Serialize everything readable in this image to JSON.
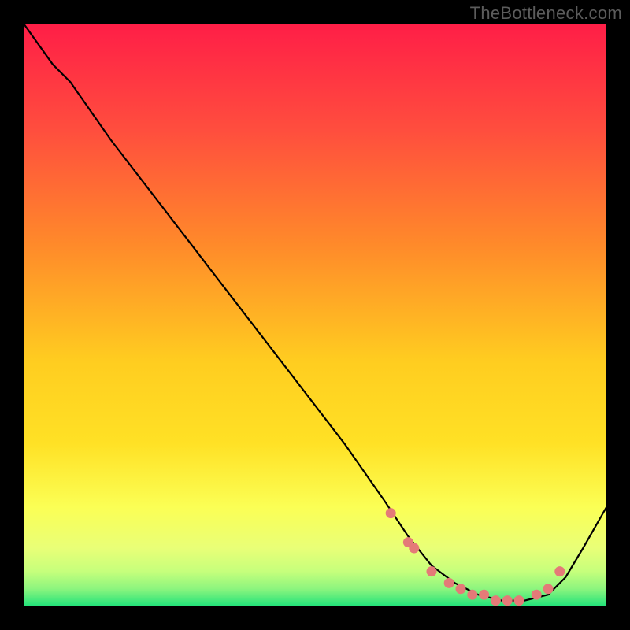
{
  "watermark": "TheBottleneck.com",
  "colors": {
    "dot": "#e47a78",
    "curve": "#000000",
    "gradient_top": "#ff1e47",
    "gradient_mid1": "#ff8a2a",
    "gradient_mid2": "#ffe125",
    "gradient_mid3": "#f8ff6a",
    "gradient_mid4": "#c8ff78",
    "gradient_bottom": "#20e27a"
  },
  "chart_data": {
    "type": "line",
    "title": "",
    "xlabel": "",
    "ylabel": "",
    "xlim": [
      0,
      100
    ],
    "ylim": [
      0,
      100
    ],
    "series": [
      {
        "name": "bottleneck-curve",
        "x": [
          0,
          5,
          8,
          15,
          25,
          35,
          45,
          55,
          62,
          66,
          70,
          74,
          78,
          82,
          86,
          90,
          93,
          96,
          100
        ],
        "y": [
          100,
          93,
          90,
          80,
          67,
          54,
          41,
          28,
          18,
          12,
          7,
          4,
          2,
          1,
          1,
          2,
          5,
          10,
          17
        ]
      }
    ],
    "markers": {
      "name": "highlight-dots",
      "x": [
        63,
        66,
        67,
        70,
        73,
        75,
        77,
        79,
        81,
        83,
        85,
        88,
        90,
        92
      ],
      "y": [
        16,
        11,
        10,
        6,
        4,
        3,
        2,
        2,
        1,
        1,
        1,
        2,
        3,
        6
      ]
    }
  }
}
